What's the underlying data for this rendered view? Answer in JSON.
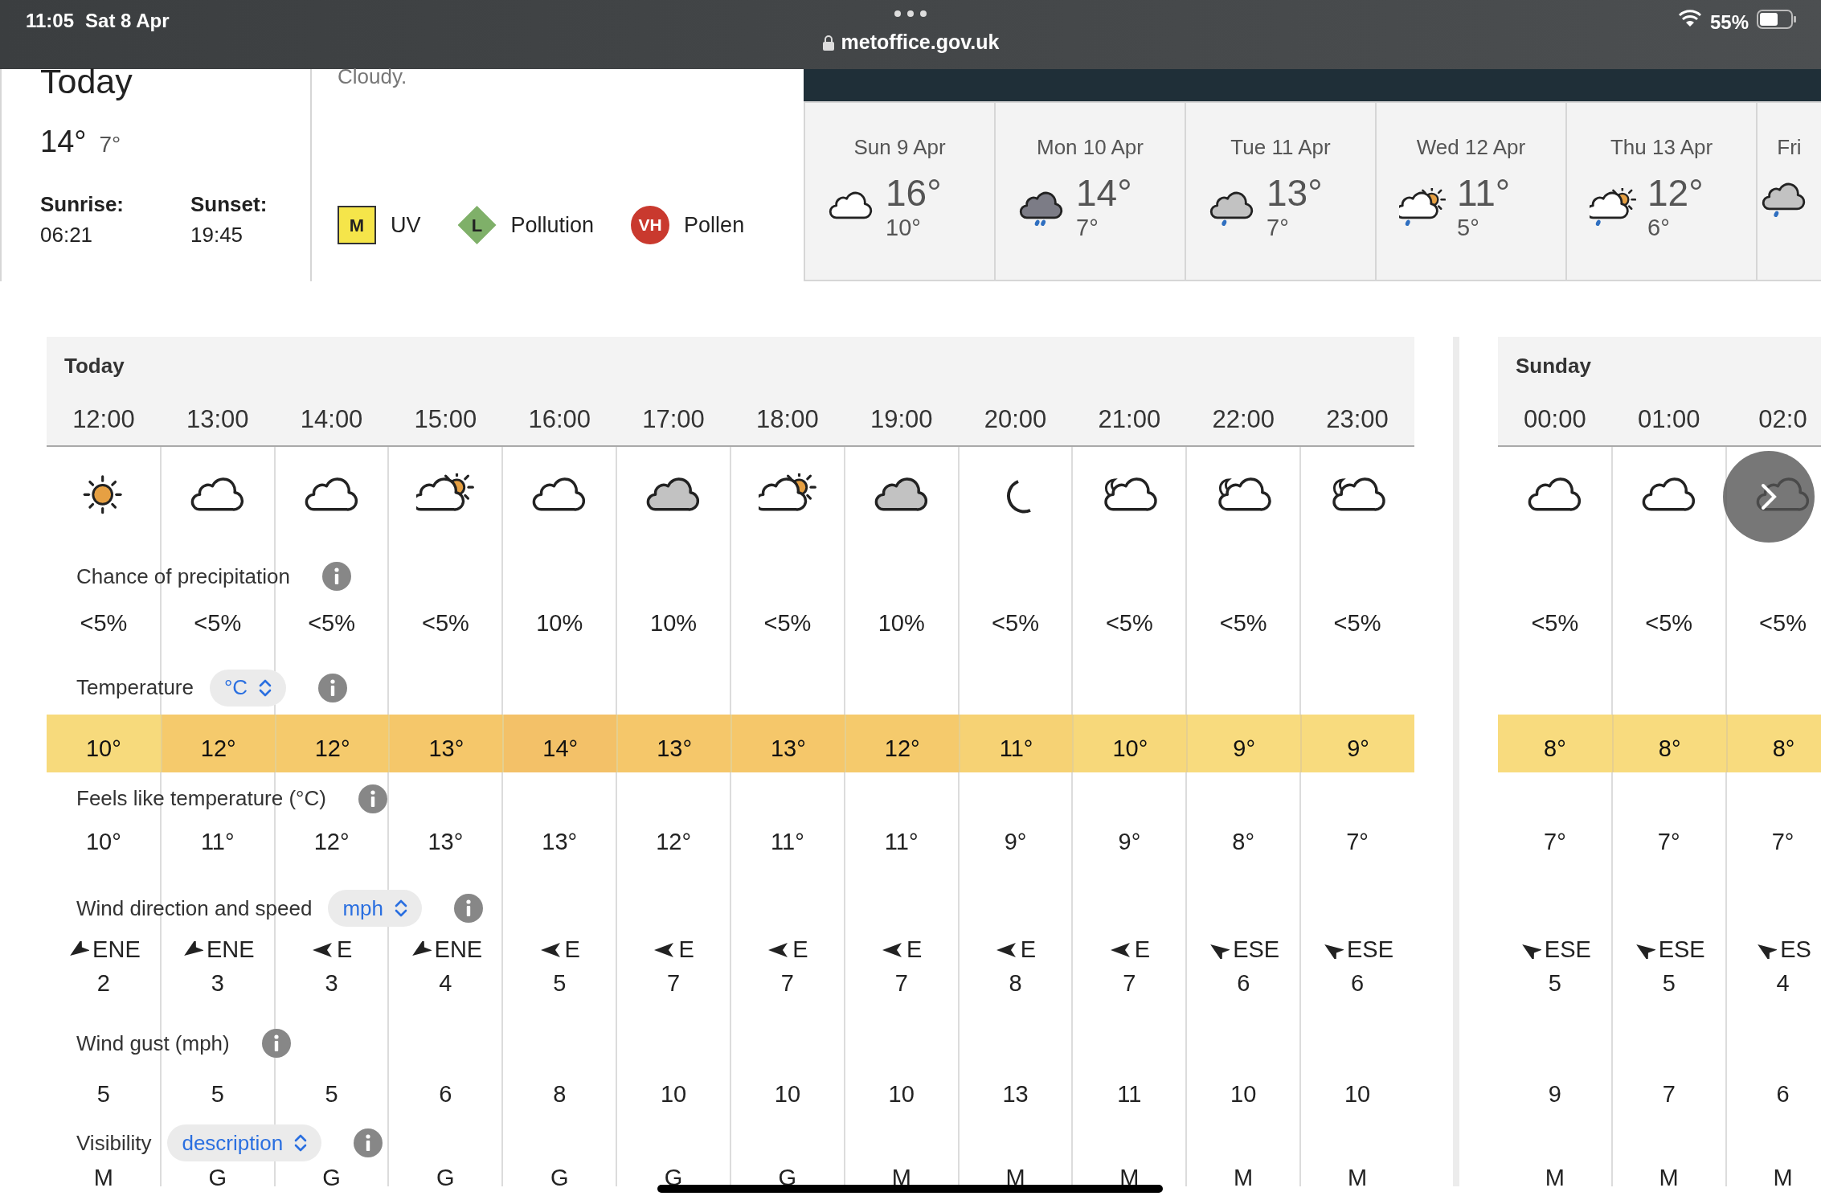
{
  "status_bar": {
    "time": "11:05",
    "date": "Sat 8 Apr",
    "url": "metoffice.gov.uk",
    "battery": "55%"
  },
  "today_summary": {
    "title": "Today",
    "high": "14°",
    "low": "7°",
    "sunrise_label": "Sunrise:",
    "sunrise": "06:21",
    "sunset_label": "Sunset:",
    "sunset": "19:45"
  },
  "description": "Cloudy.",
  "indices": [
    {
      "kind": "square",
      "code": "M",
      "label": "UV",
      "color": "#f5e54a"
    },
    {
      "kind": "diamond",
      "code": "L",
      "label": "Pollution",
      "color": "#7fb069"
    },
    {
      "kind": "circle",
      "code": "VH",
      "label": "Pollen",
      "color": "#c9392e"
    }
  ],
  "days": [
    {
      "date": "Sun 9 Apr",
      "kind": "cloud",
      "high": "16°",
      "low": "10°"
    },
    {
      "date": "Mon 10 Apr",
      "kind": "heavy-rain",
      "high": "14°",
      "low": "7°"
    },
    {
      "date": "Tue 11 Apr",
      "kind": "light-rain",
      "high": "13°",
      "low": "7°"
    },
    {
      "date": "Wed 12 Apr",
      "kind": "sun-cloud-rain",
      "high": "11°",
      "low": "5°"
    },
    {
      "date": "Thu 13 Apr",
      "kind": "sun-cloud-rain",
      "high": "12°",
      "low": "6°"
    },
    {
      "date": "Fri",
      "kind": "light-rain"
    }
  ],
  "row_labels": [
    {
      "label": "Chance of precipitation"
    },
    {
      "label": "Temperature",
      "select": "°C"
    },
    {
      "label": "Feels like temperature (°C)"
    },
    {
      "label": "Wind direction and speed",
      "select": "mph"
    },
    {
      "label": "Wind gust (mph)"
    },
    {
      "label": "Visibility",
      "select": "description"
    }
  ],
  "sections": [
    {
      "title": "Today",
      "hours": [
        {
          "time": "12:00",
          "weather": {
            "kind": "sun"
          },
          "precip": "<5%",
          "temp": "10°",
          "color": "#f7da7c",
          "feels": "10°",
          "wind": {
            "kind": "ene",
            "direction": "ENE",
            "speed": "2"
          },
          "gust": "5",
          "visibility": "M"
        },
        {
          "time": "13:00",
          "weather": {
            "kind": "cloud"
          },
          "precip": "<5%",
          "temp": "12°",
          "color": "#f5ca6c",
          "feels": "11°",
          "wind": {
            "kind": "ene",
            "direction": "ENE",
            "speed": "3"
          },
          "gust": "5",
          "visibility": "G"
        },
        {
          "time": "14:00",
          "weather": {
            "kind": "cloud"
          },
          "precip": "<5%",
          "temp": "12°",
          "color": "#f5ca6c",
          "feels": "12°",
          "wind": {
            "kind": "e",
            "direction": "E",
            "speed": "3"
          },
          "gust": "5",
          "visibility": "G"
        },
        {
          "time": "15:00",
          "weather": {
            "kind": "sun-cloud"
          },
          "precip": "<5%",
          "temp": "13°",
          "color": "#f5c76a",
          "feels": "13°",
          "wind": {
            "kind": "ene",
            "direction": "ENE",
            "speed": "4"
          },
          "gust": "6",
          "visibility": "G"
        },
        {
          "time": "16:00",
          "weather": {
            "kind": "cloud"
          },
          "precip": "10%",
          "temp": "14°",
          "color": "#f3c168",
          "feels": "13°",
          "wind": {
            "kind": "e",
            "direction": "E",
            "speed": "5"
          },
          "gust": "8",
          "visibility": "G"
        },
        {
          "time": "17:00",
          "weather": {
            "kind": "grey-cloud"
          },
          "precip": "10%",
          "temp": "13°",
          "color": "#f5c76a",
          "feels": "12°",
          "wind": {
            "kind": "e",
            "direction": "E",
            "speed": "7"
          },
          "gust": "10",
          "visibility": "G"
        },
        {
          "time": "18:00",
          "weather": {
            "kind": "sun-cloud"
          },
          "precip": "<5%",
          "temp": "13°",
          "color": "#f5c76a",
          "feels": "11°",
          "wind": {
            "kind": "e",
            "direction": "E",
            "speed": "7"
          },
          "gust": "10",
          "visibility": "G"
        },
        {
          "time": "19:00",
          "weather": {
            "kind": "grey-cloud"
          },
          "precip": "10%",
          "temp": "12°",
          "color": "#f5ca6c",
          "feels": "11°",
          "wind": {
            "kind": "e",
            "direction": "E",
            "speed": "7"
          },
          "gust": "10",
          "visibility": "M"
        },
        {
          "time": "20:00",
          "weather": {
            "kind": "moon"
          },
          "precip": "<5%",
          "temp": "11°",
          "color": "#f6d274",
          "feels": "9°",
          "wind": {
            "kind": "e",
            "direction": "E",
            "speed": "8"
          },
          "gust": "13",
          "visibility": "M"
        },
        {
          "time": "21:00",
          "weather": {
            "kind": "moon-cloud"
          },
          "precip": "<5%",
          "temp": "10°",
          "color": "#f7d87a",
          "feels": "9°",
          "wind": {
            "kind": "e",
            "direction": "E",
            "speed": "7"
          },
          "gust": "11",
          "visibility": "M"
        },
        {
          "time": "22:00",
          "weather": {
            "kind": "moon-cloud"
          },
          "precip": "<5%",
          "temp": "9°",
          "color": "#f8db7e",
          "feels": "8°",
          "wind": {
            "kind": "ese",
            "direction": "ESE",
            "speed": "6"
          },
          "gust": "10",
          "visibility": "M"
        },
        {
          "time": "23:00",
          "weather": {
            "kind": "moon-cloud"
          },
          "precip": "<5%",
          "temp": "9°",
          "color": "#f8db7e",
          "feels": "7°",
          "wind": {
            "kind": "ese",
            "direction": "ESE",
            "speed": "6"
          },
          "gust": "10",
          "visibility": "M"
        }
      ]
    },
    {
      "title": "Sunday",
      "hours": [
        {
          "time": "00:00",
          "weather": {
            "kind": "cloud"
          },
          "precip": "<5%",
          "temp": "8°",
          "color": "#f8db7e",
          "feels": "7°",
          "wind": {
            "kind": "ese",
            "direction": "ESE",
            "speed": "5"
          },
          "gust": "9",
          "visibility": "M"
        },
        {
          "time": "01:00",
          "weather": {
            "kind": "cloud"
          },
          "precip": "<5%",
          "temp": "8°",
          "color": "#f8db7e",
          "feels": "7°",
          "wind": {
            "kind": "ese",
            "direction": "ESE",
            "speed": "5"
          },
          "gust": "7",
          "visibility": "M"
        },
        {
          "time": "02:0",
          "weather": {
            "kind": "cloud"
          },
          "precip": "<5%",
          "temp": "8°",
          "color": "#f8db7e",
          "feels": "7°",
          "wind": {
            "kind": "ese",
            "direction": "ES",
            "speed": "4"
          },
          "gust": "6",
          "visibility": "M"
        }
      ]
    }
  ]
}
